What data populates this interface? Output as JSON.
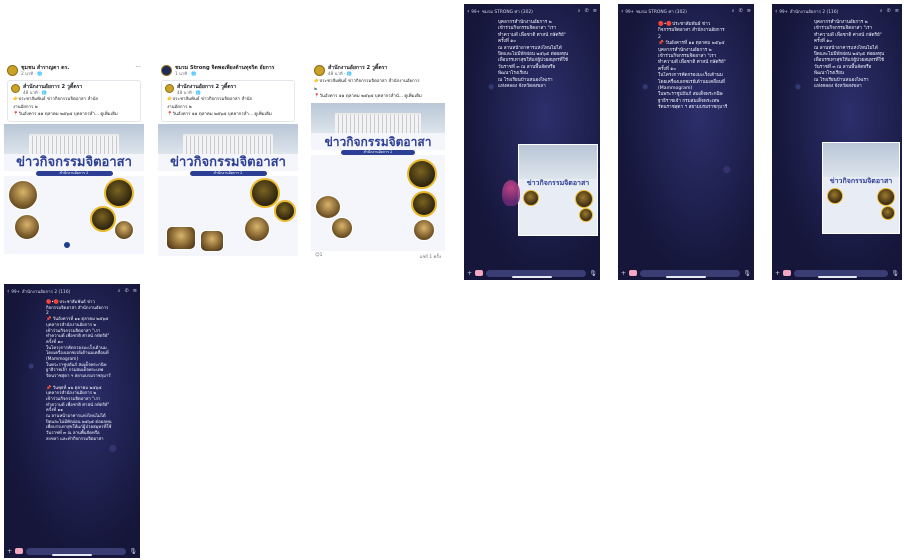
{
  "fb_posts": [
    {
      "author": "ชุมชน สำราญตา ดร.",
      "time": "2 นาที · 🌐",
      "shared_author": "สำนักงานอัยการ 2 วูดี้ตรา",
      "shared_time": "48 นาที · 🌐",
      "text_lines": [
        "👉ประชาสัมพันธ์ ข่าวกิจกรรมจิตอาสา สำนัก",
        "งานอัยการ ๒",
        "📍วันอังคาร ๑๑ ตุลาคม ๒๕๖๕ บุคลากรสำ... ดูเพิ่มเติม"
      ],
      "poster_title": "ข่าวกิจกรรมจิตอาสา",
      "poster_band": "สำนักงานอัยการ 2"
    },
    {
      "author": "ชมรม Strong จิตพอเพียงต้านทุจริต อัยการ",
      "time": "1 นาที · 🌐",
      "shared_author": "สำนักงานอัยการ 2 วูดี้ตรา",
      "shared_time": "48 นาที · 🌐",
      "text_lines": [
        "👉ประชาสัมพันธ์ ข่าวกิจกรรมจิตอาสา สำนัก",
        "งานอัยการ ๒",
        "📍วันอังคาร ๑๑ ตุลาคม ๒๕๖๕ บุคลากรสำ... ดูเพิ่มเติม"
      ],
      "poster_title": "ข่าวกิจกรรมจิตอาสา",
      "poster_band": "สำนักงานอัยการ 2"
    },
    {
      "author": "สำนักงานอัยการ 2 วูดี้ตรา",
      "time": "48 นาที · 🌐",
      "text_lines": [
        "👉ประชาสัมพันธ์ ข่าวกิจกรรมจิตอาสา สำนักงานอัยการ",
        "๒",
        "📍วันอังคาร ๑๑ ตุลาคม ๒๕๖๕ บุคลากรสำนั... ดูเพิ่มเติม"
      ],
      "poster_title": "ข่าวกิจกรรมจิตอาสา",
      "poster_band": "สำนักงานอัยการ 2",
      "reactions": "😊1",
      "shares": "แชร์ 1 ครั้ง"
    }
  ],
  "chats": [
    {
      "badge": "99+",
      "title": "ชมรม STRONG ศา (302)",
      "text": "บุคลากรสำนักงานอัยการ ๒\nเข้าร่วมกิจกรรมจิตอาสา \"เรา\nทำความดี เพื่อชาติ ศาสน์ กษัตริย์\"\nครั้งที่ ๑๐\nณ ลานหน้าอาคารแห่งไหนไม่ได้\nปิดและไม่มีพักผ่อน ๒๕๖๕ ต่อผลทุน\nเพื่อบรรเทาสุขให้แก่ผู้ป่วยสมุทรที่ใช้\nวันราชที่ ๓ ณ ลานพื้นจัดหรือ\nพัฒนาโรงเรียน\nณ โรงเรียนบ้านหนองไพเรา\nแห่งคลอง จังหวัดสงขลา",
      "mermaid": true
    },
    {
      "badge": "99+",
      "title": "ชมรม STRONG ศา (302)",
      "text": "🔴•🔴ประชาสัมพันธ์ ข่าว\nกิจกรรมจิตอาสา สำนักงานอัยการ\n2\n📌 วันอังคารที่ ๑๑ ตุลาคม ๒๕๖๕\nบุคลากรสำนักงานอัยการ ๒\nเข้าร่วมกิจกรรมจิตอาสา \"เรา\nทำความดี เพื่อชาติ ศาสน์ กษัตริย์\"\nครั้งที่ ๑๐\nในโครงการคัดกรองมะเร็งเต้านม\nโดยเครื่องเอกซเรย์เต้านมเคลื่อนที่\n(Mammogram)\nในพระราชูปถัมภ์ สมเด็จพระกนิษ\nฐาธิราชเจ้า กรมสมเด็จพระเทพ\nรัตนราชสุดา ฯ สยามบรมราชกุมารี",
      "mermaid": false
    },
    {
      "badge": "99+",
      "title": "สำนักงานอัยการ 2 (116)",
      "text": "บุคลากรสำนักงานอัยการ ๒\nเข้าร่วมกิจกรรมจิตอาสา \"เรา\nทำความดี เพื่อชาติ ศาสน์ กษัตริย์\"\nครั้งที่ ๑๐\nณ ลานหน้าอาคารแห่งไหนไม่ได้\nปิดและไม่มีพักผ่อน ๒๕๖๕ ต่อผลทุน\nเพื่อบรรเทาสุขให้แก่ผู้ป่วยสมุทรที่ใช้\nวันราชที่ ๓ ณ ลานพื้นจัดหรือ\nพัฒนาโรงเรียน\nณ โรงเรียนบ้านหนองไพเรา\nแห่งคลอง จังหวัดสงขลา",
      "mermaid": false
    },
    {
      "badge": "99+",
      "title": "สำนักงานอัยการ 2 (116)",
      "text": "🔴•🔴ประชาสัมพันธ์ ข่าว\nกิจกรรมจิตอาสา สำนักงานอัยการ\n2\n📌 วันอังคารที่ ๑๑ ตุลาคม ๒๕๖๕\nบุคลากรสำนักงานอัยการ ๒\nเข้าร่วมกิจกรรมจิตอาสา \"เรา\nทำความดี เพื่อชาติ ศาสน์ กษัตริย์\"\nครั้งที่ ๑๐\nในโครงการคัดกรองมะเร็งเต้านม\nโดยเครื่องเอกซเรย์เต้านมเคลื่อนที่\n(Mammogram)\nในพระราชูปถัมภ์ สมเด็จพระกนิษ\nฐาธิราชเจ้า กรมสมเด็จพระเทพ\nรัตนราชสุดา ฯ สยามบรมราชกุมารี\n\n📌 วันพุธที่ ๑๒ ตุลาคม ๒๕๖๕\nบุคลากรสำนักงานอัยการ ๒\nเข้าร่วมกิจกรรมจิตอาสา \"เรา\nทำความดี เพื่อชาติ ศาสน์ กษัตริย์\"\nครั้งที่ ๑๑\nณ ลานหน้าอาคารแห่งไหนไม่ได้\nปิดและไม่มีพักผ่อน ๒๕๖๕ ต่อผลทุน\nเพื่อบรรเทาสุขให้แก่ผู้ป่วยสมุทรที่ใช้\nวันราชที่ ๓ ณ ลานพื้นจัดหรือ\nสงขลา และทำกิจกรรมจิตอาสา",
      "mermaid": false
    }
  ],
  "icons": {
    "back": "‹",
    "search": "⌕",
    "phone": "✆",
    "menu": "≡",
    "more": "···",
    "plus": "+",
    "mic": "🎙"
  }
}
